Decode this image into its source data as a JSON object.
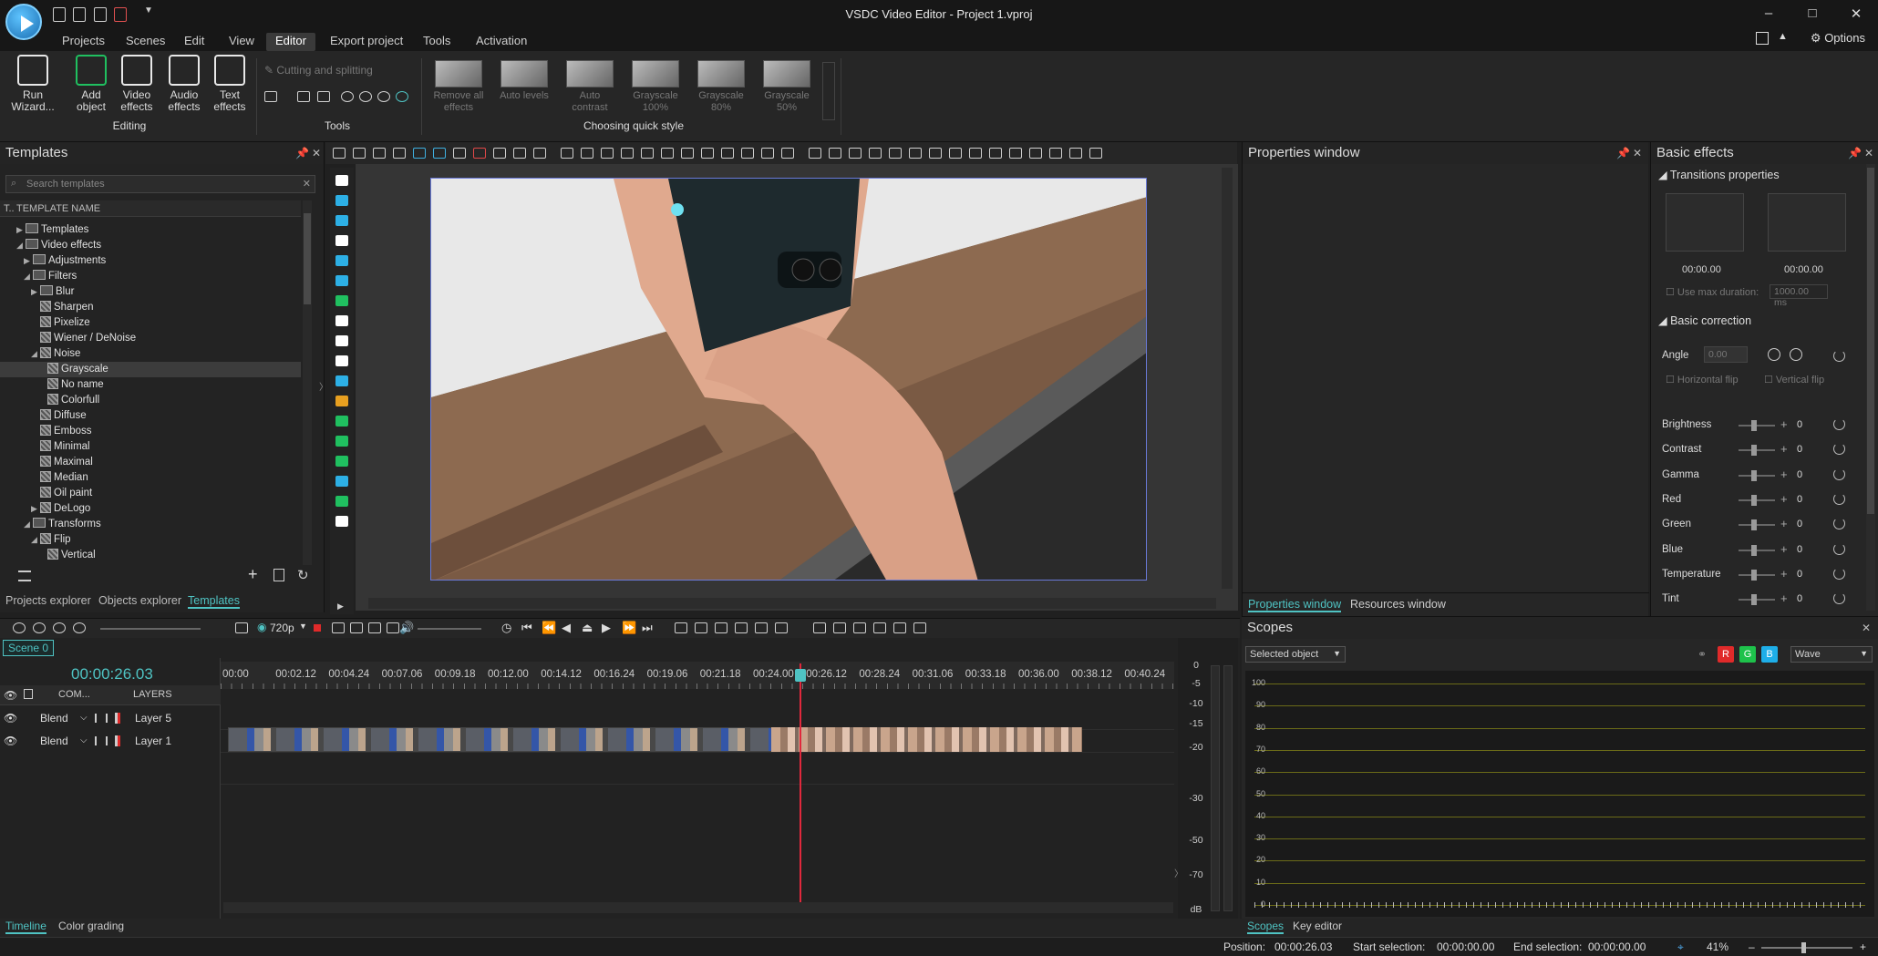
{
  "window": {
    "title": "VSDC Video Editor - Project 1.vproj",
    "options": "Options"
  },
  "menu": [
    "Projects",
    "Scenes",
    "Edit",
    "View",
    "Editor",
    "Export project",
    "Tools",
    "Activation"
  ],
  "menu_active": "Editor",
  "ribbon": {
    "editing": [
      {
        "label1": "Run",
        "label2": "Wizard...",
        "icon": "wand-icon"
      },
      {
        "label1": "Add",
        "label2": "object",
        "icon": "add-object-icon"
      },
      {
        "label1": "Video",
        "label2": "effects",
        "icon": "video-effects-icon"
      },
      {
        "label1": "Audio",
        "label2": "effects",
        "icon": "audio-effects-icon"
      },
      {
        "label1": "Text",
        "label2": "effects",
        "icon": "text-effects-icon"
      }
    ],
    "editing_group": "Editing",
    "cutting": "Cutting and splitting",
    "tools_group": "Tools",
    "quick_styles": [
      {
        "l1": "Remove all",
        "l2": "effects"
      },
      {
        "l1": "Auto levels",
        "l2": ""
      },
      {
        "l1": "Auto",
        "l2": "contrast"
      },
      {
        "l1": "Grayscale",
        "l2": "100%"
      },
      {
        "l1": "Grayscale",
        "l2": "80%"
      },
      {
        "l1": "Grayscale",
        "l2": "50%"
      }
    ],
    "quick_group": "Choosing quick style"
  },
  "templates": {
    "title": "Templates",
    "search_placeholder": "Search templates",
    "col_t": "T..",
    "col_name": "TEMPLATE NAME",
    "tree": [
      {
        "label": "Templates",
        "indent": 1,
        "exp": "▶",
        "kind": "folder"
      },
      {
        "label": "Video effects",
        "indent": 1,
        "exp": "◢",
        "kind": "folder"
      },
      {
        "label": "Adjustments",
        "indent": 2,
        "exp": "▶",
        "kind": "folder"
      },
      {
        "label": "Filters",
        "indent": 2,
        "exp": "◢",
        "kind": "folder"
      },
      {
        "label": "Blur",
        "indent": 3,
        "exp": "▶",
        "kind": "folder"
      },
      {
        "label": "Sharpen",
        "indent": 3,
        "exp": "",
        "kind": "fx"
      },
      {
        "label": "Pixelize",
        "indent": 3,
        "exp": "",
        "kind": "fx"
      },
      {
        "label": "Wiener / DeNoise",
        "indent": 3,
        "exp": "",
        "kind": "fx"
      },
      {
        "label": "Noise",
        "indent": 3,
        "exp": "◢",
        "kind": "fx"
      },
      {
        "label": "Grayscale",
        "indent": 4,
        "exp": "",
        "kind": "fx",
        "sel": true
      },
      {
        "label": "No name",
        "indent": 4,
        "exp": "",
        "kind": "fx"
      },
      {
        "label": "Colorfull",
        "indent": 4,
        "exp": "",
        "kind": "fx"
      },
      {
        "label": "Diffuse",
        "indent": 3,
        "exp": "",
        "kind": "fx"
      },
      {
        "label": "Emboss",
        "indent": 3,
        "exp": "",
        "kind": "fx"
      },
      {
        "label": "Minimal",
        "indent": 3,
        "exp": "",
        "kind": "fx"
      },
      {
        "label": "Maximal",
        "indent": 3,
        "exp": "",
        "kind": "fx"
      },
      {
        "label": "Median",
        "indent": 3,
        "exp": "",
        "kind": "fx"
      },
      {
        "label": "Oil paint",
        "indent": 3,
        "exp": "",
        "kind": "fx"
      },
      {
        "label": "DeLogo",
        "indent": 3,
        "exp": "▶",
        "kind": "fx"
      },
      {
        "label": "Transforms",
        "indent": 2,
        "exp": "◢",
        "kind": "folder"
      },
      {
        "label": "Flip",
        "indent": 3,
        "exp": "◢",
        "kind": "fx"
      },
      {
        "label": "Vertical",
        "indent": 4,
        "exp": "",
        "kind": "fx"
      }
    ],
    "tabs": [
      "Projects explorer",
      "Objects explorer",
      "Templates"
    ]
  },
  "properties": {
    "title": "Properties window",
    "tabs": [
      "Properties window",
      "Resources window"
    ]
  },
  "basic": {
    "title": "Basic effects",
    "transitions": "Transitions properties",
    "t1": "00:00.00",
    "t2": "00:00.00",
    "max_dur": "Use max duration:",
    "max_val": "1000.00 ms",
    "correction": "Basic correction",
    "angle": "Angle",
    "angle_val": "0.00",
    "hflip": "Horizontal flip",
    "vflip": "Vertical flip",
    "params": [
      {
        "name": "Brightness",
        "value": "0"
      },
      {
        "name": "Contrast",
        "value": "0"
      },
      {
        "name": "Gamma",
        "value": "0"
      },
      {
        "name": "Red",
        "value": "0"
      },
      {
        "name": "Green",
        "value": "0"
      },
      {
        "name": "Blue",
        "value": "0"
      },
      {
        "name": "Temperature",
        "value": "0"
      },
      {
        "name": "Tint",
        "value": "0"
      }
    ]
  },
  "timeline": {
    "resolution": "720p",
    "scene": "Scene 0",
    "timecode": "00:00:26.03",
    "ruler": [
      "00:00",
      "00:02.12",
      "00:04.24",
      "00:07.06",
      "00:09.18",
      "00:12.00",
      "00:14.12",
      "00:16.24",
      "00:19.06",
      "00:21.18",
      "00:24.00",
      "00:26.12",
      "00:28.24",
      "00:31.06",
      "00:33.18",
      "00:36.00",
      "00:38.12",
      "00:40.24"
    ],
    "col_com": "COM...",
    "col_layers": "LAYERS",
    "layers": [
      {
        "blend": "Blend",
        "name": "Layer 5"
      },
      {
        "blend": "Blend",
        "name": "Layer 1"
      }
    ],
    "db": [
      "0",
      "-5",
      "-10",
      "-15",
      "-20",
      "-30",
      "-50",
      "-70",
      "dB"
    ]
  },
  "scopes": {
    "title": "Scopes",
    "selector": "Selected object",
    "mode": "Wave",
    "r": "R",
    "g": "G",
    "b": "B",
    "grid": [
      "100",
      "90",
      "80",
      "70",
      "60",
      "50",
      "40",
      "30",
      "20",
      "10",
      "0"
    ],
    "tabs": [
      "Scopes",
      "Key editor"
    ]
  },
  "bottom_tabs": [
    "Timeline",
    "Color grading"
  ],
  "status": {
    "position_label": "Position:",
    "position": "00:00:26.03",
    "start_label": "Start selection:",
    "start": "00:00:00.00",
    "end_label": "End selection:",
    "end": "00:00:00.00",
    "zoom": "41%"
  }
}
